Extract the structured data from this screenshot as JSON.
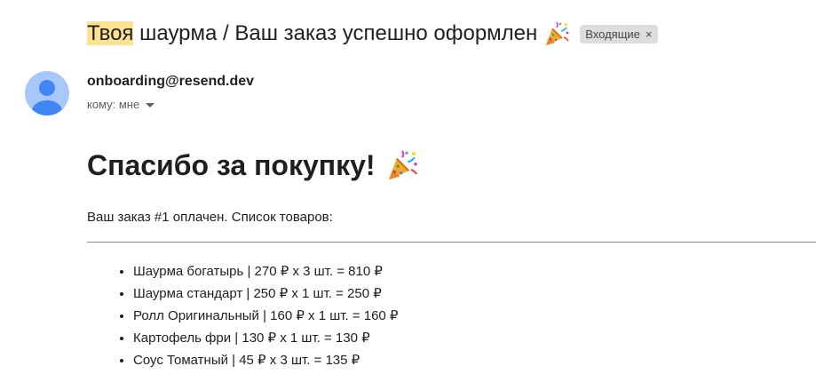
{
  "email": {
    "subject_highlight": "Твоя",
    "subject_rest": " шаурма / Ваш заказ успешно оформлен",
    "subject_emoji": "party-popper-icon",
    "label": "Входящие",
    "label_remove": "×",
    "sender": "onboarding@resend.dev",
    "recipient": "кому: мне"
  },
  "body": {
    "heading": "Спасибо за покупку!",
    "heading_emoji": "party-popper-icon",
    "intro": "Ваш заказ #1 оплачен. Список товаров:",
    "items": [
      "Шаурма богатырь | 270 ₽ x 3 шт. = 810 ₽",
      "Шаурма стандарт | 250 ₽ x 1 шт. = 250 ₽",
      "Ролл Оригинальный | 160 ₽ x 1 шт. = 160 ₽",
      "Картофель фри | 130 ₽ x 1 шт. = 130 ₽",
      "Соус Томатный | 45 ₽ x 3 шт. = 135 ₽"
    ]
  },
  "colors": {
    "highlight": "#fde293",
    "avatar_bg": "#a8c7fa",
    "avatar_fg": "#4285f4",
    "chip_bg": "#dddddd"
  }
}
